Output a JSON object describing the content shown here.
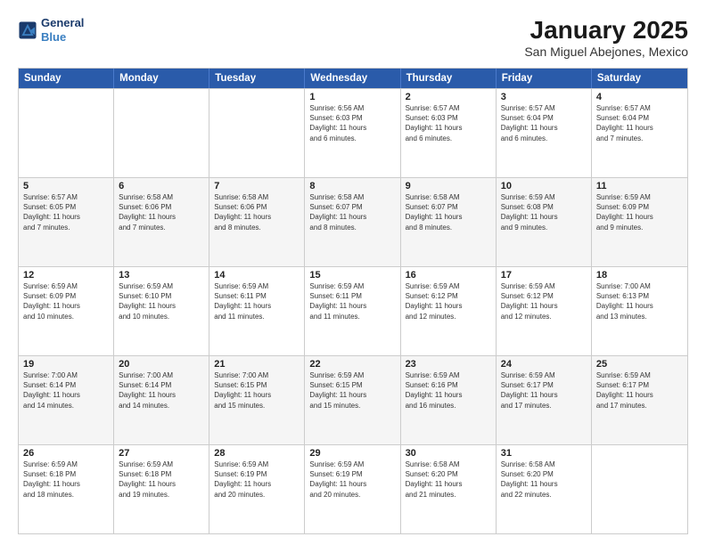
{
  "header": {
    "logo_line1": "General",
    "logo_line2": "Blue",
    "month_title": "January 2025",
    "subtitle": "San Miguel Abejones, Mexico"
  },
  "weekdays": [
    "Sunday",
    "Monday",
    "Tuesday",
    "Wednesday",
    "Thursday",
    "Friday",
    "Saturday"
  ],
  "rows": [
    {
      "alt": false,
      "cells": [
        {
          "day": "",
          "info": ""
        },
        {
          "day": "",
          "info": ""
        },
        {
          "day": "",
          "info": ""
        },
        {
          "day": "1",
          "info": "Sunrise: 6:56 AM\nSunset: 6:03 PM\nDaylight: 11 hours\nand 6 minutes."
        },
        {
          "day": "2",
          "info": "Sunrise: 6:57 AM\nSunset: 6:03 PM\nDaylight: 11 hours\nand 6 minutes."
        },
        {
          "day": "3",
          "info": "Sunrise: 6:57 AM\nSunset: 6:04 PM\nDaylight: 11 hours\nand 6 minutes."
        },
        {
          "day": "4",
          "info": "Sunrise: 6:57 AM\nSunset: 6:04 PM\nDaylight: 11 hours\nand 7 minutes."
        }
      ]
    },
    {
      "alt": true,
      "cells": [
        {
          "day": "5",
          "info": "Sunrise: 6:57 AM\nSunset: 6:05 PM\nDaylight: 11 hours\nand 7 minutes."
        },
        {
          "day": "6",
          "info": "Sunrise: 6:58 AM\nSunset: 6:06 PM\nDaylight: 11 hours\nand 7 minutes."
        },
        {
          "day": "7",
          "info": "Sunrise: 6:58 AM\nSunset: 6:06 PM\nDaylight: 11 hours\nand 8 minutes."
        },
        {
          "day": "8",
          "info": "Sunrise: 6:58 AM\nSunset: 6:07 PM\nDaylight: 11 hours\nand 8 minutes."
        },
        {
          "day": "9",
          "info": "Sunrise: 6:58 AM\nSunset: 6:07 PM\nDaylight: 11 hours\nand 8 minutes."
        },
        {
          "day": "10",
          "info": "Sunrise: 6:59 AM\nSunset: 6:08 PM\nDaylight: 11 hours\nand 9 minutes."
        },
        {
          "day": "11",
          "info": "Sunrise: 6:59 AM\nSunset: 6:09 PM\nDaylight: 11 hours\nand 9 minutes."
        }
      ]
    },
    {
      "alt": false,
      "cells": [
        {
          "day": "12",
          "info": "Sunrise: 6:59 AM\nSunset: 6:09 PM\nDaylight: 11 hours\nand 10 minutes."
        },
        {
          "day": "13",
          "info": "Sunrise: 6:59 AM\nSunset: 6:10 PM\nDaylight: 11 hours\nand 10 minutes."
        },
        {
          "day": "14",
          "info": "Sunrise: 6:59 AM\nSunset: 6:11 PM\nDaylight: 11 hours\nand 11 minutes."
        },
        {
          "day": "15",
          "info": "Sunrise: 6:59 AM\nSunset: 6:11 PM\nDaylight: 11 hours\nand 11 minutes."
        },
        {
          "day": "16",
          "info": "Sunrise: 6:59 AM\nSunset: 6:12 PM\nDaylight: 11 hours\nand 12 minutes."
        },
        {
          "day": "17",
          "info": "Sunrise: 6:59 AM\nSunset: 6:12 PM\nDaylight: 11 hours\nand 12 minutes."
        },
        {
          "day": "18",
          "info": "Sunrise: 7:00 AM\nSunset: 6:13 PM\nDaylight: 11 hours\nand 13 minutes."
        }
      ]
    },
    {
      "alt": true,
      "cells": [
        {
          "day": "19",
          "info": "Sunrise: 7:00 AM\nSunset: 6:14 PM\nDaylight: 11 hours\nand 14 minutes."
        },
        {
          "day": "20",
          "info": "Sunrise: 7:00 AM\nSunset: 6:14 PM\nDaylight: 11 hours\nand 14 minutes."
        },
        {
          "day": "21",
          "info": "Sunrise: 7:00 AM\nSunset: 6:15 PM\nDaylight: 11 hours\nand 15 minutes."
        },
        {
          "day": "22",
          "info": "Sunrise: 6:59 AM\nSunset: 6:15 PM\nDaylight: 11 hours\nand 15 minutes."
        },
        {
          "day": "23",
          "info": "Sunrise: 6:59 AM\nSunset: 6:16 PM\nDaylight: 11 hours\nand 16 minutes."
        },
        {
          "day": "24",
          "info": "Sunrise: 6:59 AM\nSunset: 6:17 PM\nDaylight: 11 hours\nand 17 minutes."
        },
        {
          "day": "25",
          "info": "Sunrise: 6:59 AM\nSunset: 6:17 PM\nDaylight: 11 hours\nand 17 minutes."
        }
      ]
    },
    {
      "alt": false,
      "cells": [
        {
          "day": "26",
          "info": "Sunrise: 6:59 AM\nSunset: 6:18 PM\nDaylight: 11 hours\nand 18 minutes."
        },
        {
          "day": "27",
          "info": "Sunrise: 6:59 AM\nSunset: 6:18 PM\nDaylight: 11 hours\nand 19 minutes."
        },
        {
          "day": "28",
          "info": "Sunrise: 6:59 AM\nSunset: 6:19 PM\nDaylight: 11 hours\nand 20 minutes."
        },
        {
          "day": "29",
          "info": "Sunrise: 6:59 AM\nSunset: 6:19 PM\nDaylight: 11 hours\nand 20 minutes."
        },
        {
          "day": "30",
          "info": "Sunrise: 6:58 AM\nSunset: 6:20 PM\nDaylight: 11 hours\nand 21 minutes."
        },
        {
          "day": "31",
          "info": "Sunrise: 6:58 AM\nSunset: 6:20 PM\nDaylight: 11 hours\nand 22 minutes."
        },
        {
          "day": "",
          "info": ""
        }
      ]
    }
  ]
}
